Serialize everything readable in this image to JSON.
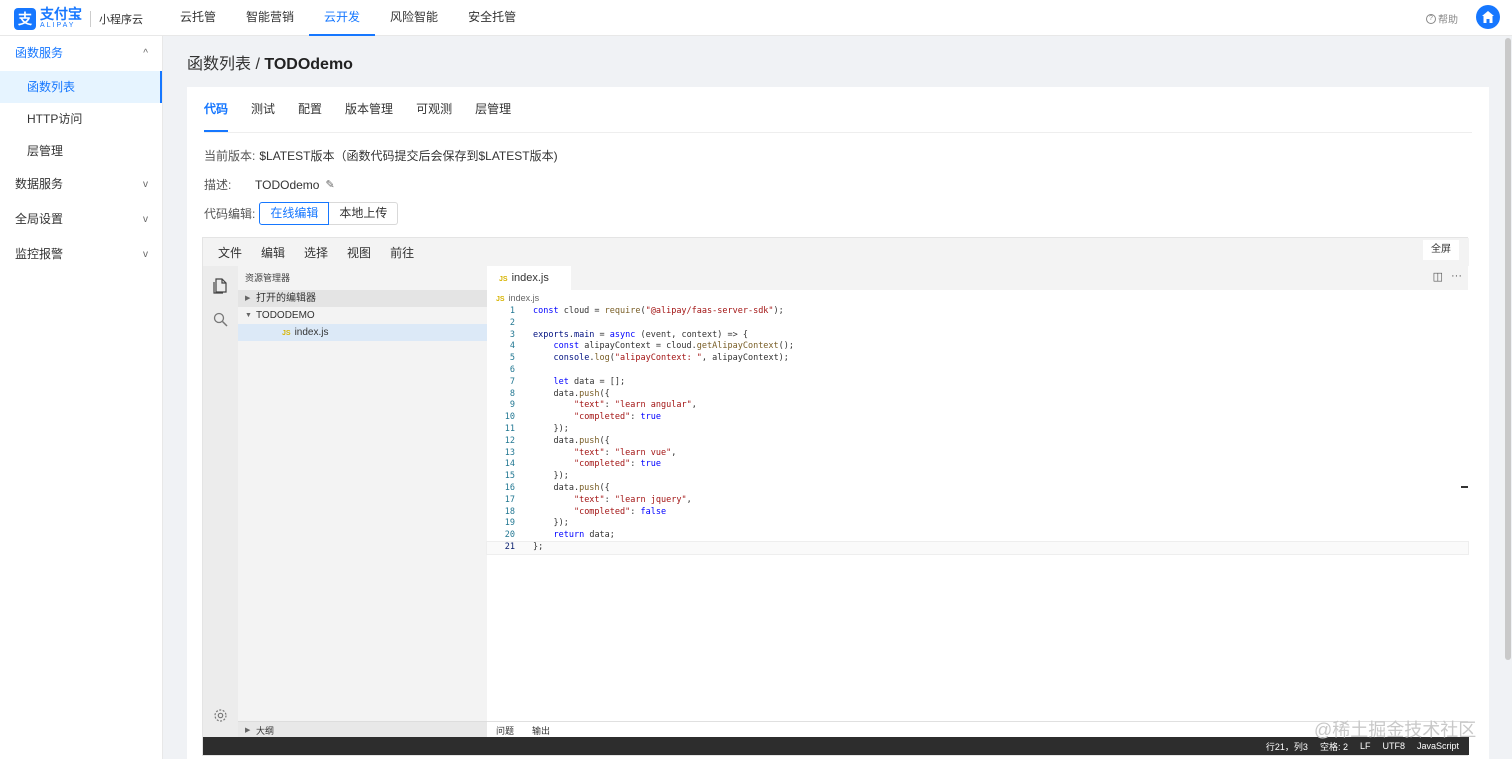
{
  "brand": {
    "logo_glyph": "支",
    "name_cn": "支付宝",
    "name_en": "ALIPAY",
    "sub": "小程序云",
    "color": "#1677ff"
  },
  "topnav": [
    {
      "label": "云托管",
      "active": false
    },
    {
      "label": "智能营销",
      "active": false
    },
    {
      "label": "云开发",
      "active": true
    },
    {
      "label": "风险智能",
      "active": false
    },
    {
      "label": "安全托管",
      "active": false
    }
  ],
  "header": {
    "help_label": "帮助",
    "help_icon": "question-circle-icon",
    "home_icon": "home-icon"
  },
  "sidebar": {
    "groups": [
      {
        "label": "函数服务",
        "open": true,
        "chevron": "^",
        "items": [
          {
            "label": "函数列表",
            "active": true
          },
          {
            "label": "HTTP访问",
            "active": false
          },
          {
            "label": "层管理",
            "active": false
          }
        ]
      },
      {
        "label": "数据服务",
        "open": false,
        "chevron": "v"
      },
      {
        "label": "全局设置",
        "open": false,
        "chevron": "v"
      },
      {
        "label": "监控报警",
        "open": false,
        "chevron": "v"
      }
    ]
  },
  "page": {
    "title_prefix": "函数列表 / ",
    "title_name": "TODOdemo"
  },
  "tabs": [
    {
      "label": "代码",
      "active": true
    },
    {
      "label": "测试",
      "active": false
    },
    {
      "label": "配置",
      "active": false
    },
    {
      "label": "版本管理",
      "active": false
    },
    {
      "label": "可观测",
      "active": false
    },
    {
      "label": "层管理",
      "active": false
    }
  ],
  "info": {
    "version_label": "当前版本:",
    "version_value": "$LATEST版本（函数代码提交后会保存到$LATEST版本)",
    "desc_label": "描述:",
    "desc_value": "TODOdemo",
    "edit_label": "代码编辑:",
    "online_edit": "在线编辑",
    "local_upload": "本地上传"
  },
  "ide": {
    "menus": [
      "文件",
      "编辑",
      "选择",
      "视图",
      "前往"
    ],
    "fullscreen": "全屏",
    "explorer_title": "资源管理器",
    "open_editors": "打开的编辑器",
    "project": "TODODEMO",
    "file_badge": "JS",
    "file_name": "index.js",
    "outline": "大纲",
    "tab_name": "index.js",
    "breadcrumb": "index.js",
    "panel_tabs": [
      "问题",
      "输出"
    ],
    "status": {
      "position": "行21，列3",
      "spaces": "空格: 2",
      "eol": "LF",
      "encoding": "UTF8",
      "language": "JavaScript"
    },
    "code_lines": [
      "const cloud = require(\"@alipay/faas-server-sdk\");",
      "",
      "exports.main = async (event, context) => {",
      "    const alipayContext = cloud.getAlipayContext();",
      "    console.log(\"alipayContext: \", alipayContext);",
      "",
      "    let data = [];",
      "    data.push({",
      "        \"text\": \"learn angular\",",
      "        \"completed\": true",
      "    });",
      "    data.push({",
      "        \"text\": \"learn vue\",",
      "        \"completed\": true",
      "    });",
      "    data.push({",
      "        \"text\": \"learn jquery\",",
      "        \"completed\": false",
      "    });",
      "    return data;",
      "};"
    ],
    "current_line": 21
  },
  "watermark": "@稀土掘金技术社区"
}
